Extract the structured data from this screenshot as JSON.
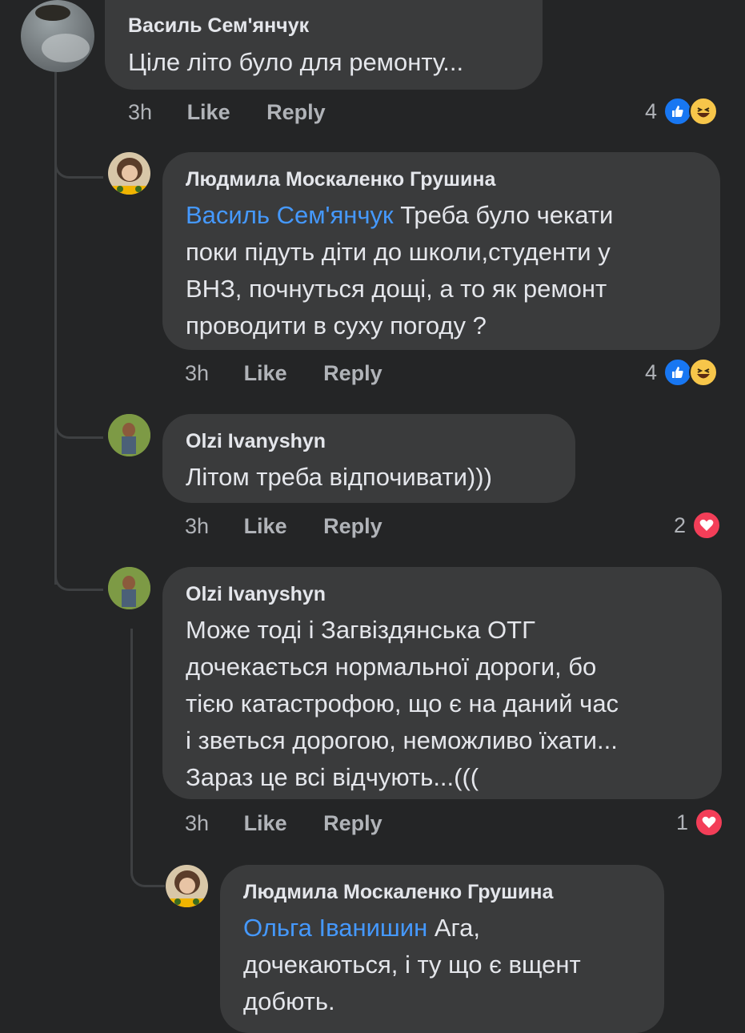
{
  "comments": [
    {
      "author": "Василь Сем'янчук",
      "text": "Ціле літо було для ремонту...",
      "time": "3h",
      "like": "Like",
      "reply": "Reply",
      "reaction_count": "4",
      "reactions": [
        "like-icon",
        "haha-icon"
      ]
    },
    {
      "author": "Людмила Москаленко Грушина",
      "mention": "Василь Сем'янчук",
      "lines": [
        " Треба було чекати",
        "поки підуть діти до школи,студенти у",
        "ВНЗ,  почнуться дощі, а то  як ремонт",
        "проводити в суху погоду ?"
      ],
      "time": "3h",
      "like": "Like",
      "reply": "Reply",
      "reaction_count": "4",
      "reactions": [
        "like-icon",
        "haha-icon"
      ]
    },
    {
      "author": "Olzi Ivanyshyn",
      "text": "Літом треба відпочивати)))",
      "time": "3h",
      "like": "Like",
      "reply": "Reply",
      "reaction_count": "2",
      "reactions": [
        "love-icon"
      ]
    },
    {
      "author": "Olzi Ivanyshyn",
      "lines": [
        "Може тоді і Загвіздянська ОТГ",
        "дочекається нормальної дороги, бо",
        "тією катастрофою, що є на даний час",
        "і зветься дорогою, неможливо їхати...",
        "Зараз це всі відчують...((("
      ],
      "time": "3h",
      "like": "Like",
      "reply": "Reply",
      "reaction_count": "1",
      "reactions": [
        "love-icon"
      ]
    },
    {
      "author": "Людмила Москаленко Грушина",
      "mention": "Ольга Іванишин",
      "lines": [
        " Ага,",
        "дочекаються, і ту що є вщент",
        "добють."
      ]
    }
  ],
  "colors": {
    "background": "#242526",
    "bubble": "#3a3b3c",
    "mention": "#4599ff",
    "like": "#1877f2",
    "love": "#f33e58",
    "haha": "#f7c64a"
  }
}
